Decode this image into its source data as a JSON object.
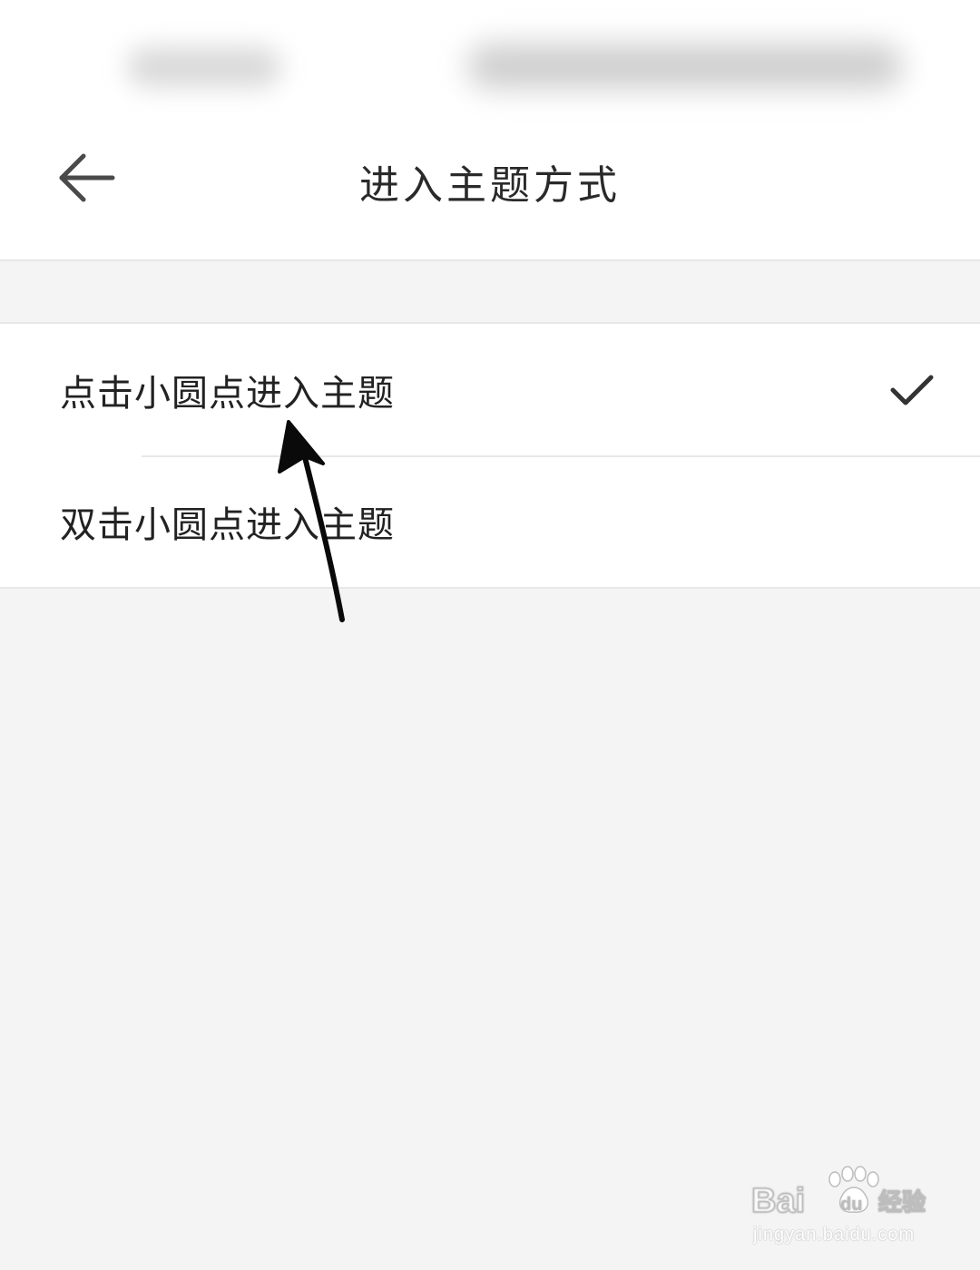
{
  "header": {
    "title": "进入主题方式",
    "back_icon": "arrow-left-icon"
  },
  "options": [
    {
      "label": "点击小圆点进入主题",
      "selected": true
    },
    {
      "label": "双击小圆点进入主题",
      "selected": false
    }
  ],
  "check_icon": "checkmark-icon",
  "colors": {
    "page_background": "#f4f4f4",
    "card_background": "#ffffff",
    "text": "#222222",
    "divider": "#e8e8e8"
  },
  "watermark": {
    "logo_text": "Baidu经验",
    "url": "jingyan.baidu.com"
  }
}
